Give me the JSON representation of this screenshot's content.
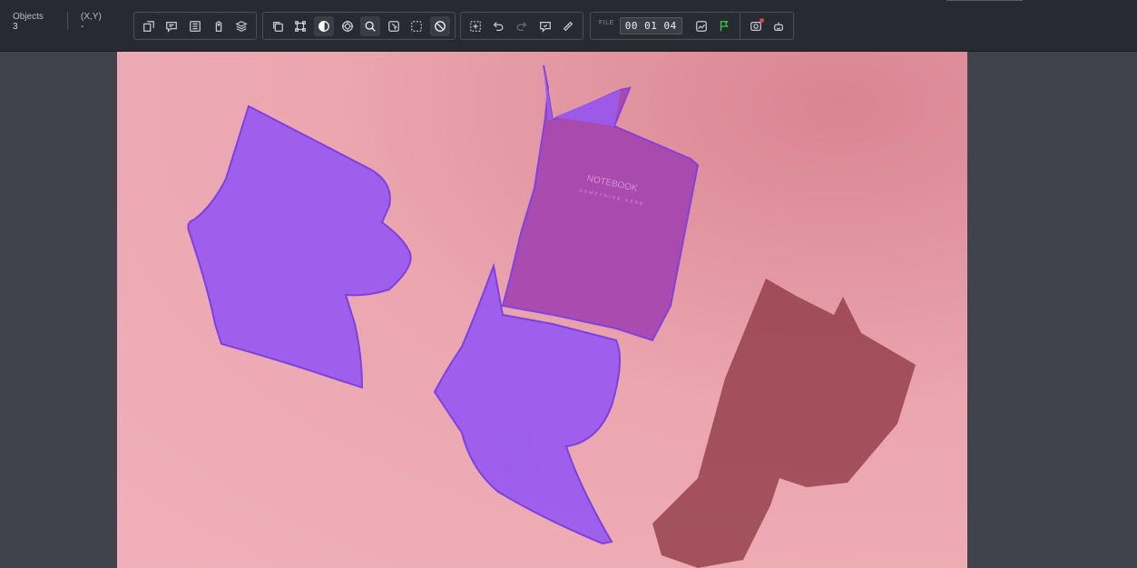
{
  "stats": {
    "objects_label": "Objects",
    "objects_value": "3",
    "coords_label": "(X,Y)",
    "coords_value": "-"
  },
  "toolbar": {
    "group1": [
      "crop-icon",
      "comment-icon",
      "list-icon",
      "tag-icon",
      "layers-icon"
    ],
    "group2": [
      "copy-icon",
      "bounding-box-icon",
      "contrast-icon",
      "target-icon",
      "search-icon",
      "pointer-icon",
      "select-area-icon",
      "slash-icon"
    ],
    "group3": [
      "add-region-icon",
      "undo-icon",
      "redo-icon",
      "review-icon",
      "ruler-icon"
    ],
    "file_label": "FILE",
    "timer": "00 01 04",
    "group4": [
      "trend-icon",
      "flag-icon"
    ],
    "group5": [
      "camera-icon",
      "robot-icon"
    ],
    "flag_color": "#3ecf4a",
    "notification_color": "#e2404c"
  },
  "image": {
    "notebook_title": "NOTEBOOK",
    "notebook_subtitle": "SOMETHING HERE",
    "background_color": "#eaa4ae",
    "mask_color": "#9b5cf0"
  }
}
